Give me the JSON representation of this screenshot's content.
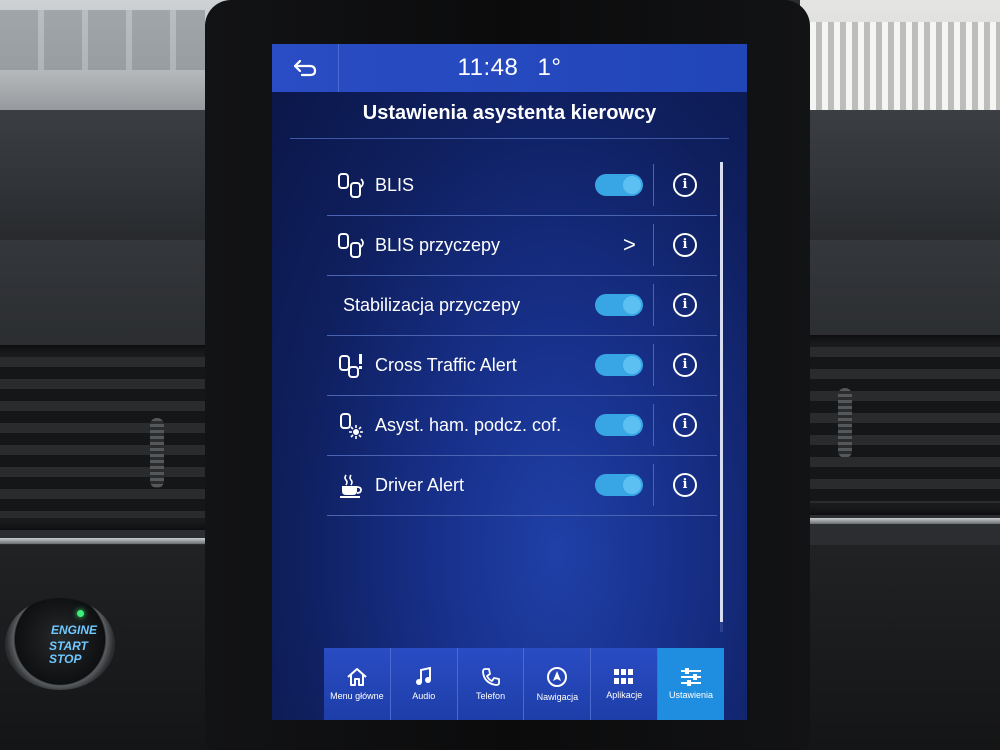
{
  "status_bar": {
    "time": "11:48",
    "temperature": "1°"
  },
  "page_title": "Ustawienia asystenta kierowcy",
  "settings": [
    {
      "label": "BLIS",
      "icon": "blind-spot-icon",
      "control": "toggle",
      "enabled": true
    },
    {
      "label": "BLIS przyczepy",
      "icon": "blind-spot-icon",
      "control": "chevron",
      "chevron": ">"
    },
    {
      "label": "Stabilizacja przyczepy",
      "icon": "",
      "control": "toggle",
      "enabled": true
    },
    {
      "label": "Cross Traffic Alert",
      "icon": "cross-traffic-icon",
      "control": "toggle",
      "enabled": true
    },
    {
      "label": "Asyst. ham. podcz. cof.",
      "icon": "reverse-brake-icon",
      "control": "toggle",
      "enabled": true
    },
    {
      "label": "Driver Alert",
      "icon": "coffee-cup-icon",
      "control": "toggle",
      "enabled": true
    }
  ],
  "info_glyph": "i",
  "nav": [
    {
      "label": "Menu główne",
      "icon": "home-icon"
    },
    {
      "label": "Audio",
      "icon": "music-note-icon"
    },
    {
      "label": "Telefon",
      "icon": "phone-icon"
    },
    {
      "label": "Nawigacja",
      "icon": "navigation-icon"
    },
    {
      "label": "Aplikacje",
      "icon": "apps-grid-icon"
    },
    {
      "label": "Ustawienia",
      "icon": "sliders-icon",
      "active": true
    }
  ],
  "engine_button": {
    "line1": "ENGINE",
    "line2": "START",
    "line3": "STOP"
  },
  "colors": {
    "accent": "#2a4cc4",
    "toggle_on": "#38a6e4",
    "active_tab": "#1f8ee0"
  }
}
